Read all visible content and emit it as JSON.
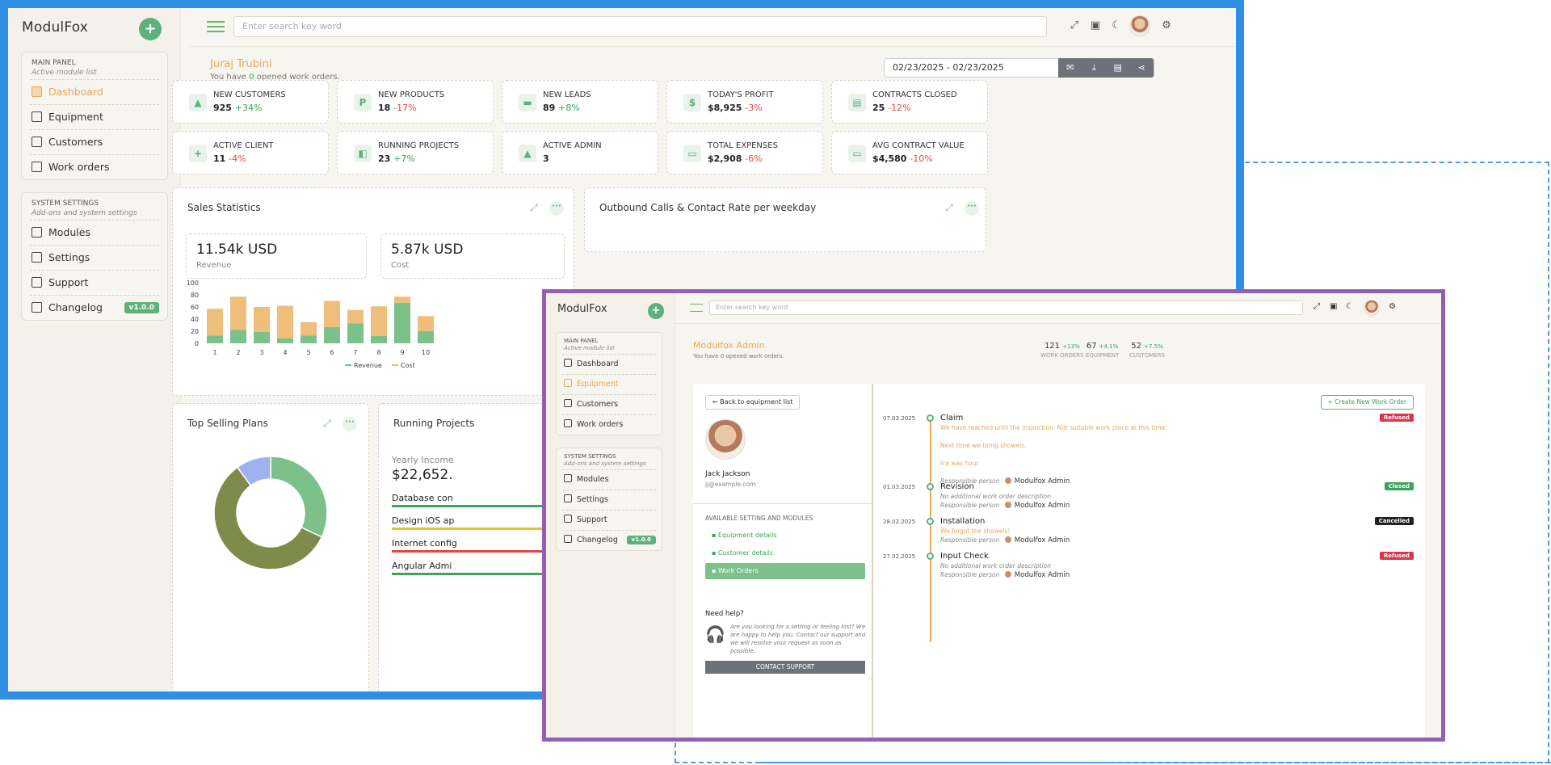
{
  "screen1": {
    "logo": "ModulFox",
    "main_panel": {
      "title": "MAIN PANEL",
      "subtitle": "Active module list",
      "items": [
        {
          "label": "Dashboard",
          "icon": "home-icon",
          "active": true
        },
        {
          "label": "Equipment",
          "icon": "equipment-icon"
        },
        {
          "label": "Customers",
          "icon": "customers-icon"
        },
        {
          "label": "Work orders",
          "icon": "work-orders-icon"
        }
      ]
    },
    "system_settings": {
      "title": "SYSTEM SETTINGS",
      "subtitle": "Add-ons and system settings",
      "items": [
        {
          "label": "Modules",
          "icon": "modules-icon"
        },
        {
          "label": "Settings",
          "icon": "settings-icon"
        },
        {
          "label": "Support",
          "icon": "support-icon"
        },
        {
          "label": "Changelog",
          "icon": "changelog-icon",
          "badge": "v1.0.0"
        }
      ]
    },
    "search_placeholder": "Enter search key word",
    "user_name": "Juraj Trubini",
    "user_sub_prefix": "You have ",
    "user_sub_count": "0",
    "user_sub_suffix": " opened work orders.",
    "date_range": "02/23/2025 - 02/23/2025",
    "cards": [
      {
        "label": "NEW CUSTOMERS",
        "value": "925",
        "change": "+34%",
        "trend": "up",
        "icon": "user-icon"
      },
      {
        "label": "NEW PRODUCTS",
        "value": "18",
        "change": "-17%",
        "trend": "down",
        "icon": "product-icon"
      },
      {
        "label": "NEW LEADS",
        "value": "89",
        "change": "+8%",
        "trend": "up",
        "icon": "briefcase-icon"
      },
      {
        "label": "TODAY'S PROFIT",
        "value": "$8,925",
        "change": "-3%",
        "trend": "down",
        "icon": "dollar-icon"
      },
      {
        "label": "CONTRACTS CLOSED",
        "value": "25",
        "change": "-12%",
        "trend": "down",
        "icon": "document-icon"
      },
      {
        "label": "ACTIVE CLIENT",
        "value": "11",
        "change": "-4%",
        "trend": "down",
        "icon": "user-plus-icon"
      },
      {
        "label": "RUNNING PROJECTS",
        "value": "23",
        "change": "+7%",
        "trend": "up",
        "icon": "projects-icon"
      },
      {
        "label": "ACTIVE ADMIN",
        "value": "3",
        "change": "",
        "trend": "up",
        "icon": "admin-icon"
      },
      {
        "label": "TOTAL EXPENSES",
        "value": "$2,908",
        "change": "-6%",
        "trend": "down",
        "icon": "cash-icon"
      },
      {
        "label": "AVG CONTRACT VALUE",
        "value": "$4,580",
        "change": "-10%",
        "trend": "down",
        "icon": "cash-icon"
      }
    ],
    "sales": {
      "title": "Sales Statistics",
      "revenue_value": "11.54k USD",
      "revenue_label": "Revenue",
      "cost_value": "5.87k USD",
      "cost_label": "Cost"
    },
    "outbound_title": "Outbound Calls & Contact Rate per weekday",
    "top_selling_title": "Top Selling Plans",
    "running_projects": {
      "title": "Running Projects",
      "yearly_label": "Yearly Income",
      "yearly_value": "$22,652.",
      "items": [
        {
          "label": "Database con",
          "color": "#3aa35c"
        },
        {
          "label": "Design iOS ap",
          "color": "#e6c12f"
        },
        {
          "label": "Internet config",
          "color": "#e04747"
        },
        {
          "label": "Angular Admi",
          "color": "#3aa35c"
        }
      ]
    },
    "colors": {
      "frame": "#2f8fe5",
      "accent": "#5cb27a",
      "orange": "#e9a857"
    }
  },
  "chart_data": [
    {
      "type": "bar",
      "stacked": true,
      "categories": [
        "1",
        "2",
        "3",
        "4",
        "5",
        "6",
        "7",
        "8",
        "9",
        "10"
      ],
      "series": [
        {
          "name": "Revenue",
          "color": "#7cc08a",
          "values": [
            13,
            22,
            19,
            8,
            13,
            27,
            33,
            12,
            67,
            20
          ]
        },
        {
          "name": "Cost",
          "color": "#efbd7c",
          "values": [
            44,
            55,
            41,
            54,
            22,
            43,
            22,
            49,
            10,
            25
          ]
        }
      ],
      "ylim": [
        0,
        100
      ],
      "yticks": [
        0,
        20,
        40,
        60,
        80,
        100
      ],
      "legend": "bottom"
    },
    {
      "type": "pie",
      "donut": true,
      "slices": [
        {
          "value": 32,
          "color": "#7cc08a"
        },
        {
          "value": 58,
          "color": "#7e8b4a"
        },
        {
          "value": 10,
          "color": "#9fb2ef"
        }
      ]
    }
  ],
  "screen2": {
    "logo": "ModulFox",
    "main_panel": {
      "title": "MAIN PANEL",
      "subtitle": "Active module list",
      "items": [
        {
          "label": "Dashboard",
          "icon": "home-icon"
        },
        {
          "label": "Equipment",
          "icon": "equipment-icon",
          "active": true
        },
        {
          "label": "Customers",
          "icon": "customers-icon"
        },
        {
          "label": "Work orders",
          "icon": "work-orders-icon"
        }
      ]
    },
    "system_settings": {
      "title": "SYSTEM SETTINGS",
      "subtitle": "Add-ons and system settings",
      "items": [
        {
          "label": "Modules",
          "icon": "modules-icon"
        },
        {
          "label": "Settings",
          "icon": "settings-icon"
        },
        {
          "label": "Support",
          "icon": "support-icon"
        },
        {
          "label": "Changelog",
          "icon": "changelog-icon",
          "badge": "v1.0.0"
        }
      ]
    },
    "search_placeholder": "Enter search key word",
    "admin_name": "Modulfox Admin",
    "admin_sub": "You have 0 opened work orders.",
    "kpis": [
      {
        "value": "121",
        "change": "+13%",
        "label": "WORK ORDERS"
      },
      {
        "value": "67",
        "change": "+4.1%",
        "label": "EQUIPMENT"
      },
      {
        "value": "52",
        "change": "+7.5%",
        "label": "CUSTOMERS"
      }
    ],
    "back_button": "Back to equipment list",
    "create_button": "Create New Work Order",
    "customer_name": "Jack Jackson",
    "customer_email": "jj@example.com",
    "settings_heading": "AVAILABLE SETTING AND MODULES",
    "modules": [
      {
        "label": "Equipment details",
        "icon": "document-icon"
      },
      {
        "label": "Customer details",
        "icon": "user-icon"
      },
      {
        "label": "Work Orders",
        "icon": "list-icon",
        "active": true
      }
    ],
    "help_title": "Need help?",
    "help_text": "Are you looking for a setting or feeling lost? We are happy to help you. Contact our support and we will resolve your request as soon as possible.",
    "contact_button": "CONTACT SUPPORT",
    "timeline": [
      {
        "date": "07.03.2025",
        "title": "Claim",
        "badge": "Refused",
        "badge_color": "#d9364a",
        "lines": [
          {
            "text": "We have reached until the inspection. Not suitable work place at this time.",
            "style": "orange"
          },
          {
            "text": "Next time we bring showels.",
            "style": "orange"
          },
          {
            "text": "Ice was hour",
            "style": "orange"
          }
        ],
        "responsible_label": "Responsible person",
        "responsible": "Modulfox Admin"
      },
      {
        "date": "01.03.2025",
        "title": "Revision",
        "badge": "Closed",
        "badge_color": "#3aa35c",
        "lines": [
          {
            "text": "No additional work order description",
            "style": "muted"
          }
        ],
        "responsible_label": "Responsible person",
        "responsible": "Modulfox Admin"
      },
      {
        "date": "28.02.2025",
        "title": "Installation",
        "badge": "Cancelled",
        "badge_color": "#222222",
        "lines": [
          {
            "text": "We forgot the showels!",
            "style": "orange"
          }
        ],
        "responsible_label": "Responsible person",
        "responsible": "Modulfox Admin"
      },
      {
        "date": "27.02.2025",
        "title": "Input Check",
        "badge": "Refused",
        "badge_color": "#d9364a",
        "lines": [
          {
            "text": "No additional work order description",
            "style": "muted"
          }
        ],
        "responsible_label": "Responsible person",
        "responsible": "Modulfox Admin"
      }
    ],
    "colors": {
      "frame": "#9360b3"
    }
  }
}
